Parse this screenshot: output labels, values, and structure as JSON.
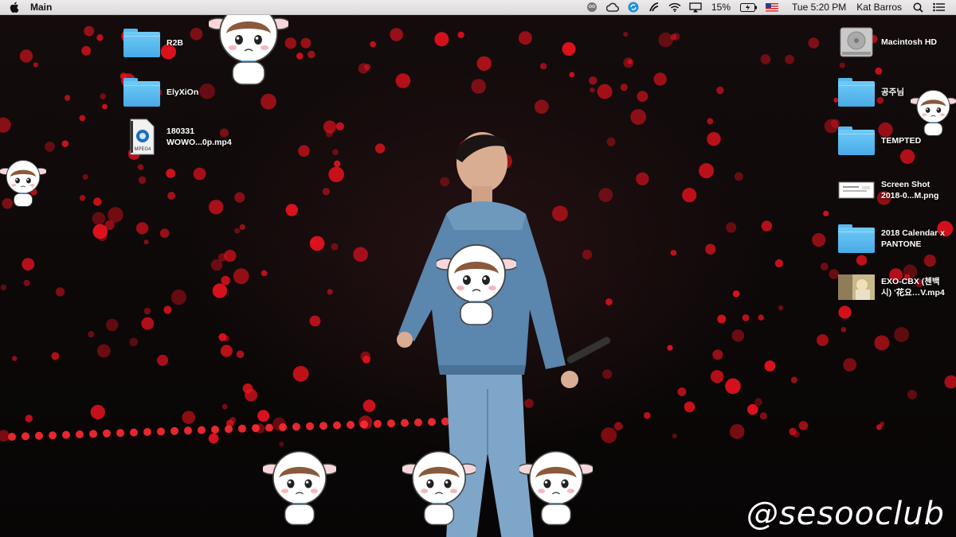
{
  "menubar": {
    "app_name": "Main",
    "battery": "15%",
    "time": "Tue 5:20 PM",
    "user": "Kat Barros",
    "icons": [
      "apple-logo-icon",
      "owl-icon",
      "creative-cloud-icon",
      "sync-icon",
      "swirl-icon",
      "wifi-icon",
      "airplay-icon",
      "battery-icon",
      "us-flag-icon",
      "search-icon",
      "list-icon"
    ]
  },
  "desktop": {
    "left_icons": [
      {
        "label": "R2B",
        "kind": "folder"
      },
      {
        "label": "ElyXiOn",
        "kind": "folder"
      },
      {
        "label_line1": "180331",
        "label_line2": "WOWO...0p.mp4",
        "kind": "mpeg4-file"
      }
    ],
    "right_icons": [
      {
        "label": "Macintosh HD",
        "kind": "hard-drive"
      },
      {
        "label": "공주님",
        "kind": "folder"
      },
      {
        "label": "TEMPTED",
        "kind": "folder"
      },
      {
        "label_line1": "Screen Shot",
        "label_line2": "2018-0...M.png",
        "kind": "screenshot-file"
      },
      {
        "label_line1": "2018 Calendar x",
        "label_line2": "PANTONE",
        "kind": "folder"
      },
      {
        "label_line1": "EXO-CBX (첸백",
        "label_line2": "시) '花요…V.mp4",
        "kind": "video-file"
      }
    ],
    "file_badge": "MPEG4"
  },
  "watermark": "@sesooclub",
  "colors": {
    "folder": "#5ab8ee",
    "lights": "#e8121e",
    "menubar": "#e6e4e4"
  }
}
